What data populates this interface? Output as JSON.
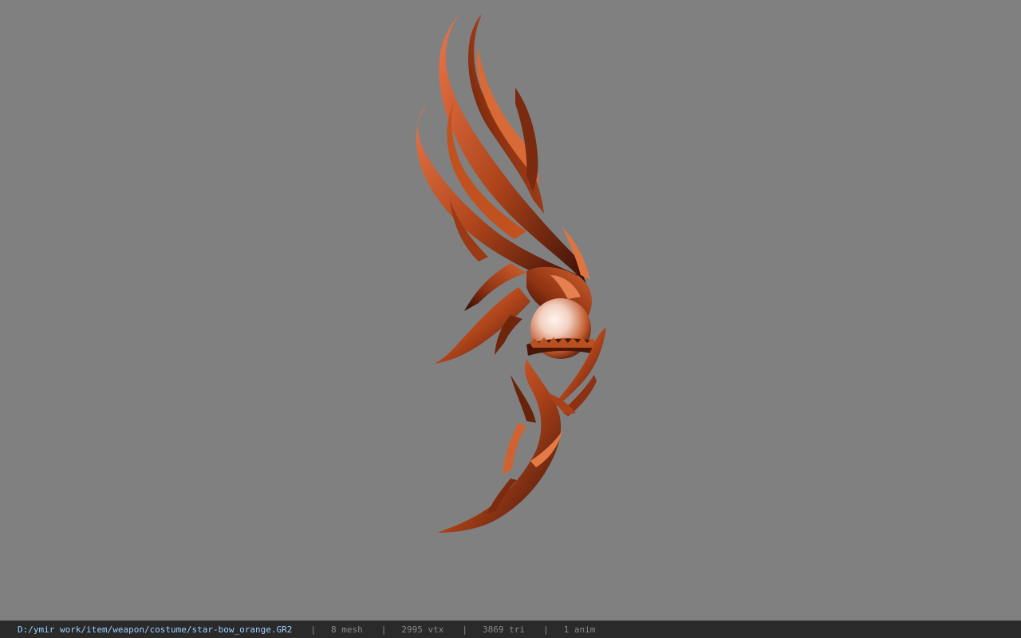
{
  "viewport": {
    "model_name": "star-bow_orange",
    "background_color": "#808080",
    "model_colors": {
      "main": "#b0451b",
      "highlight": "#e9774a",
      "shadow": "#3a0f06",
      "orb": "#f2cfc0"
    }
  },
  "statusbar": {
    "file_path": "D:/ymir work/item/weapon/costume/star-bow_orange.GR2",
    "separator": "|",
    "mesh_count": "8 mesh",
    "vertex_count": "2995 vtx",
    "triangle_count": "3869 tri",
    "anim_count": "1 anim"
  }
}
